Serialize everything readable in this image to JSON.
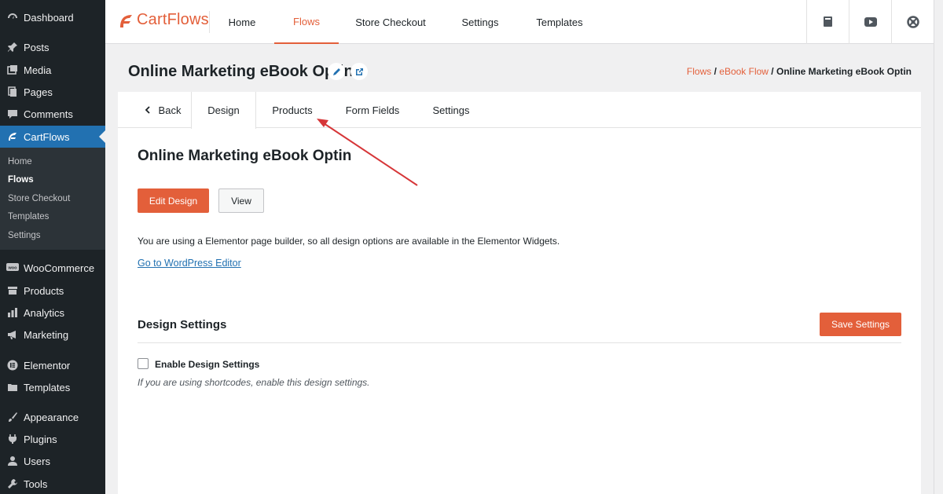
{
  "wp_menu": {
    "dashboard": "Dashboard",
    "posts": "Posts",
    "media": "Media",
    "pages": "Pages",
    "comments": "Comments",
    "cartflows": "CartFlows",
    "woocommerce": "WooCommerce",
    "products": "Products",
    "analytics": "Analytics",
    "marketing": "Marketing",
    "elementor": "Elementor",
    "templates": "Templates",
    "appearance": "Appearance",
    "plugins": "Plugins",
    "users": "Users",
    "tools": "Tools"
  },
  "cartflows_submenu": [
    "Home",
    "Flows",
    "Store Checkout",
    "Templates",
    "Settings"
  ],
  "topbar": {
    "brand": "CartFlows",
    "tabs": [
      "Home",
      "Flows",
      "Store Checkout",
      "Settings",
      "Templates"
    ],
    "active_tab": "Flows",
    "accent": "#e35f3a"
  },
  "header": {
    "title": "Online Marketing eBook Optin",
    "breadcrumb": {
      "part1": "Flows",
      "sep": " / ",
      "part2": "eBook Flow",
      "current": "Online Marketing eBook Optin"
    }
  },
  "step_tabs": {
    "back": "Back",
    "design": "Design",
    "products": "Products",
    "form_fields": "Form Fields",
    "settings": "Settings"
  },
  "design_panel": {
    "title": "Online Marketing eBook Optin",
    "edit_design": "Edit Design",
    "view": "View",
    "info": "You are using a Elementor page builder, so all design options are available in the Elementor Widgets.",
    "editor_link": "Go to WordPress Editor",
    "settings_title": "Design Settings",
    "save_settings": "Save Settings",
    "enable_label": "Enable Design Settings",
    "enable_checked": false,
    "hint": "If you are using shortcodes, enable this design settings."
  },
  "colors": {
    "wp_sidebar": "#1d2327",
    "wp_active": "#2271b1",
    "annotation_arrow": "#d63638"
  }
}
